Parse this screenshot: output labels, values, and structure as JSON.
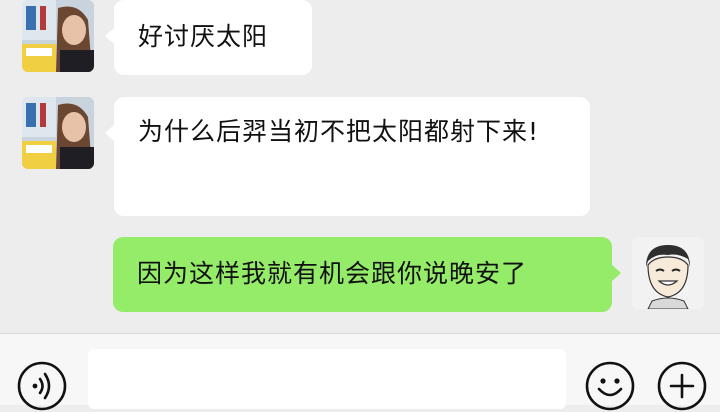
{
  "messages": [
    {
      "sender": "other",
      "text": "好讨厌太阳"
    },
    {
      "sender": "other",
      "text": "为什么后羿当初不把太阳都射下来!"
    },
    {
      "sender": "self",
      "text": "因为这样我就有机会跟你说晚安了"
    }
  ],
  "input_bar": {
    "voice_icon": "voice-icon",
    "emoji_icon": "emoji-icon",
    "add_icon": "plus-icon",
    "message_value": ""
  },
  "colors": {
    "background": "#ededed",
    "incoming_bubble": "#ffffff",
    "outgoing_bubble": "#95ec69",
    "input_bar": "#f7f7f7"
  }
}
